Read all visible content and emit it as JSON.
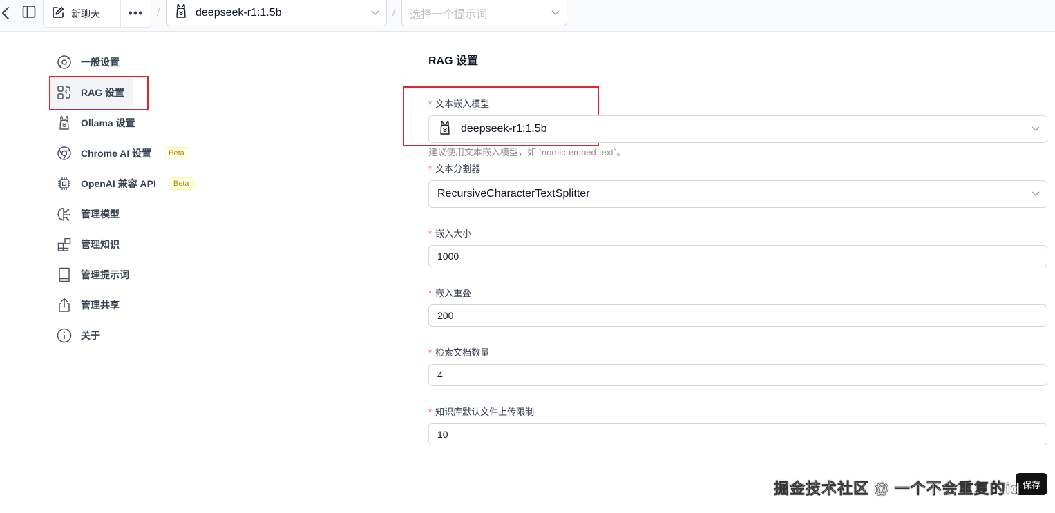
{
  "header": {
    "new_chat_label": "新聊天",
    "more_label": "•••",
    "separator": "/",
    "model_value": "deepseek-r1:1.5b",
    "prompt_placeholder": "选择一个提示词"
  },
  "nav": {
    "items": [
      {
        "label": "一般设置",
        "icon": "settings-orbit-icon"
      },
      {
        "label": "RAG 设置",
        "icon": "rag-icon",
        "active": true
      },
      {
        "label": "Ollama 设置",
        "icon": "ollama-llama-icon"
      },
      {
        "label": "Chrome AI 设置",
        "icon": "chrome-icon",
        "badge": "Beta"
      },
      {
        "label": "OpenAI 兼容 API",
        "icon": "cpu-chip-icon",
        "badge": "Beta"
      },
      {
        "label": "管理模型",
        "icon": "brain-icon"
      },
      {
        "label": "管理知识",
        "icon": "blocks-icon"
      },
      {
        "label": "管理提示词",
        "icon": "book-icon"
      },
      {
        "label": "管理共享",
        "icon": "share-icon"
      },
      {
        "label": "关于",
        "icon": "info-icon"
      }
    ]
  },
  "main": {
    "title": "RAG 设置",
    "embedding_model": {
      "label": "文本嵌入模型",
      "value": "deepseek-r1:1.5b",
      "help": "建议使用文本嵌入模型，如 `nomic-embed-text`。"
    },
    "splitter": {
      "label": "文本分割器",
      "value": "RecursiveCharacterTextSplitter"
    },
    "chunk_size": {
      "label": "嵌入大小",
      "value": "1000"
    },
    "chunk_overlap": {
      "label": "嵌入重叠",
      "value": "200"
    },
    "retrieved_docs": {
      "label": "检索文档数量",
      "value": "4"
    },
    "upload_limit": {
      "label": "知识库默认文件上传限制",
      "value": "10"
    },
    "required_mark": "*",
    "save_label": "保存"
  },
  "watermark": "掘金技术社区 @ 一个不会重复的id",
  "colors": {
    "highlight": "#e0232d",
    "required": "#ff4d4f",
    "beta_text": "#ad8b00",
    "beta_bg": "#feffe6"
  }
}
